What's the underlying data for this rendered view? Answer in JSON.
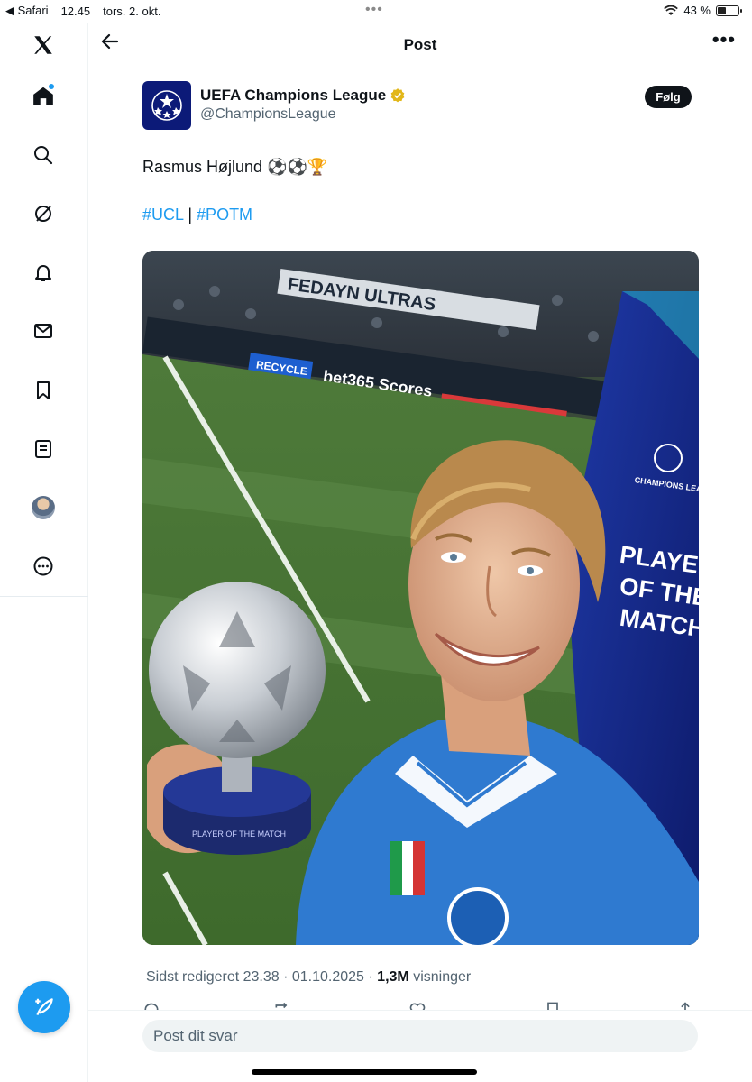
{
  "status_bar": {
    "back_app": "Safari",
    "time": "12.45",
    "date": "tors. 2. okt.",
    "battery": "43 %",
    "battery_level": 0.43
  },
  "header": {
    "title": "Post"
  },
  "post": {
    "author_name": "UEFA Champions League",
    "author_handle": "@ChampionsLeague",
    "follow_label": "Følg",
    "text": "Rasmus Højlund ⚽⚽🏆",
    "hashtag_1": "#UCL",
    "hashtag_sep": " | ",
    "hashtag_2": "#POTM",
    "edited": "Sidst redigeret 23.38 · 01.10.2025 · ",
    "views_count": "1,3M",
    "views_label": " visninger"
  },
  "photo_text": {
    "banner_1": "FEDAYN ULTRAS",
    "ad_1": "RECYCLE",
    "ad_2": "bet365 Scores",
    "board_league": "CHAMPIONS LEAGUE",
    "board_line1": "PLAYER",
    "board_line2": "OF THE",
    "board_line3": "MATCH",
    "trophy_text": "PLAYER OF THE MATCH"
  },
  "reply": {
    "placeholder": "Post dit svar"
  },
  "icons": [
    "x-logo-icon",
    "home-icon",
    "search-icon",
    "grok-icon",
    "bell-icon",
    "mail-icon",
    "bookmark-icon",
    "lists-icon",
    "profile-avatar",
    "more-circle-icon",
    "compose-icon"
  ],
  "colors": {
    "accent": "#1d9bf0",
    "verified": "#e2b719",
    "ucl_blue": "#0c1a78"
  }
}
